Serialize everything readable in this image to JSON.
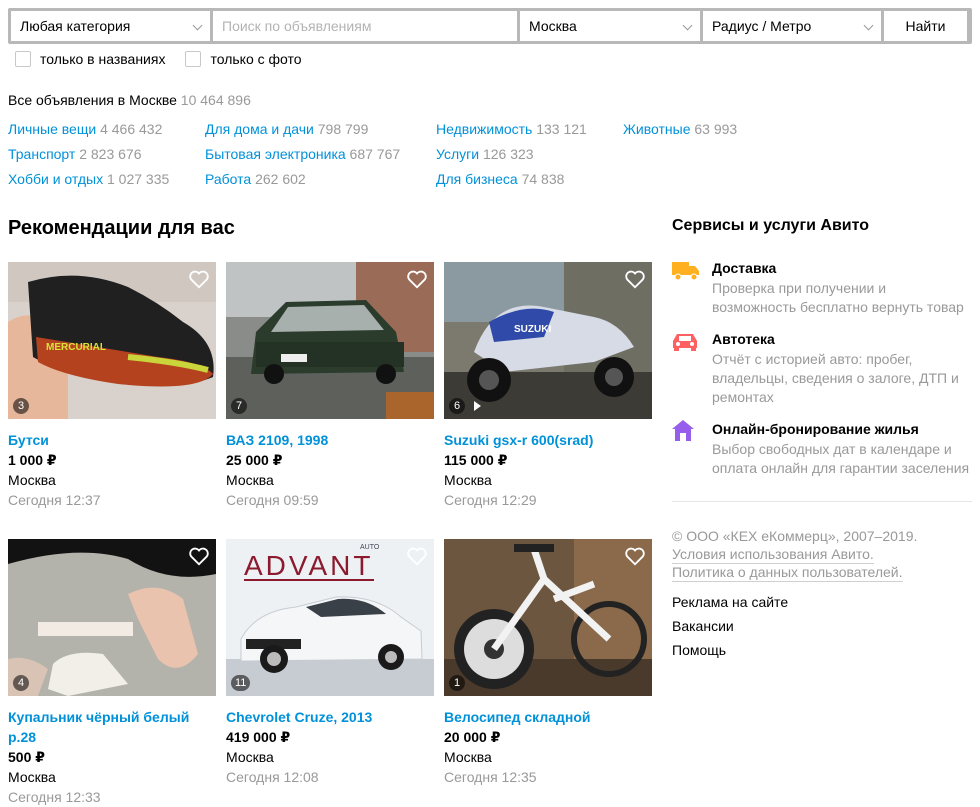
{
  "search": {
    "category": "Любая категория",
    "query_placeholder": "Поиск по объявлениям",
    "city": "Москва",
    "radius": "Радиус / Метро",
    "find_label": "Найти",
    "only_titles": "только в названиях",
    "only_photo": "только с фото"
  },
  "totals": {
    "label": "Все объявления в Москве",
    "count": "10 464 896"
  },
  "categories": [
    {
      "name": "Личные вещи",
      "count": "4 466 432"
    },
    {
      "name": "Транспорт",
      "count": "2 823 676"
    },
    {
      "name": "Хобби и отдых",
      "count": "1 027 335"
    },
    {
      "name": "Для дома и дачи",
      "count": "798 799"
    },
    {
      "name": "Бытовая электроника",
      "count": "687 767"
    },
    {
      "name": "Работа",
      "count": "262 602"
    },
    {
      "name": "Недвижимость",
      "count": "133 121"
    },
    {
      "name": "Услуги",
      "count": "126 323"
    },
    {
      "name": "Для бизнеса",
      "count": "74 838"
    },
    {
      "name": "Животные",
      "count": "63 993"
    }
  ],
  "recommendations": {
    "title": "Рекомендации для вас",
    "cards": [
      {
        "title": "Бутси",
        "price": "1 000 ₽",
        "city": "Москва",
        "time": "Сегодня 12:37",
        "photos": "3"
      },
      {
        "title": "ВАЗ 2109, 1998",
        "price": "25 000 ₽",
        "city": "Москва",
        "time": "Сегодня 09:59",
        "photos": "7"
      },
      {
        "title": "Suzuki gsx-r 600(srad)",
        "price": "115 000 ₽",
        "city": "Москва",
        "time": "Сегодня 12:29",
        "photos": "6"
      },
      {
        "title": "Купальник чёрный белый р.28",
        "price": "500 ₽",
        "city": "Москва",
        "time": "Сегодня 12:33",
        "photos": "4"
      },
      {
        "title": "Chevrolet Cruze, 2013",
        "price": "419 000 ₽",
        "city": "Москва",
        "time": "Сегодня 12:08",
        "photos": "11",
        "photo_text": "ADVANT",
        "photo_subtext": "AUTO"
      },
      {
        "title": "Велосипед складной",
        "price": "20 000 ₽",
        "city": "Москва",
        "time": "Сегодня 12:35",
        "photos": "1"
      }
    ]
  },
  "sidebar": {
    "title": "Сервисы и услуги Авито",
    "services": [
      {
        "name": "Доставка",
        "desc": "Проверка при получении и возможность бесплатно вернуть товар",
        "icon": "truck-icon",
        "color": "#ffb021"
      },
      {
        "name": "Автотека",
        "desc": "Отчёт с историей авто: пробег, владельцы, сведения о залоге, ДТП и ремонтах",
        "icon": "car-icon",
        "color": "#ff6163"
      },
      {
        "name": "Онлайн-бронирование жилья",
        "desc": "Выбор свободных дат в календаре и оплата онлайн для гарантии заселения",
        "icon": "house-icon",
        "color": "#965eeb"
      }
    ],
    "copyright": "© ООО «КЕХ еКоммерц», 2007–2019.",
    "terms": "Условия использования Авито.",
    "policy": "Политика о данных пользователей.",
    "links": [
      "Реклама на сайте",
      "Вакансии",
      "Помощь"
    ]
  },
  "colors": {
    "link": "#0091d9",
    "muted": "#999999"
  }
}
